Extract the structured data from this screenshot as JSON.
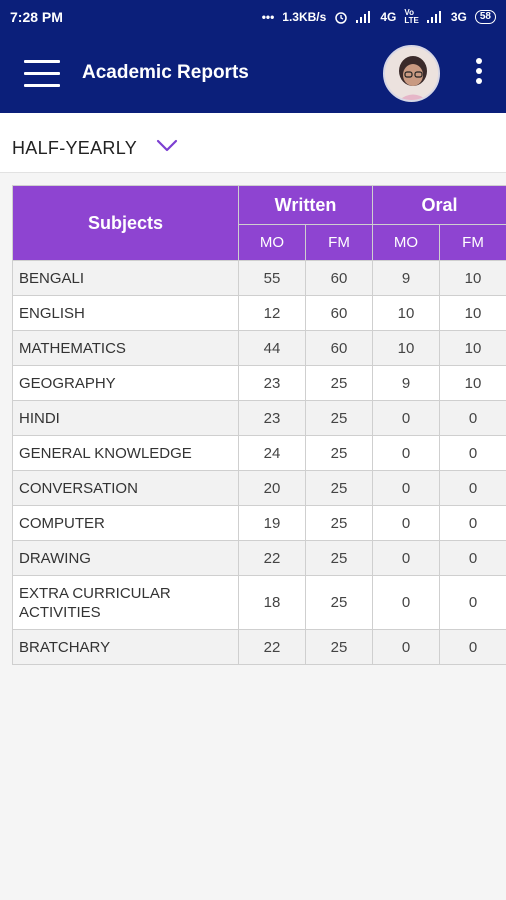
{
  "status_bar": {
    "time": "7:28 PM",
    "network_speed": "1.3KB/s",
    "network1": "4G",
    "network2": "3G",
    "battery": "58"
  },
  "app_bar": {
    "title": "Academic Reports",
    "menu_icon": "hamburger-menu-icon",
    "overflow_icon": "more-vert-icon"
  },
  "filter": {
    "selected": "HALF-YEARLY",
    "dropdown_icon": "chevron-down-icon",
    "accent": "#7c3fd1"
  },
  "colors": {
    "primary": "#0b1f7a",
    "table_header": "#8e44d1"
  },
  "table": {
    "headers": {
      "subjects": "Subjects",
      "written": "Written",
      "oral": "Oral",
      "mo": "MO",
      "fm": "FM"
    },
    "rows": [
      {
        "subject": "BENGALI",
        "written_mo": "55",
        "written_fm": "60",
        "oral_mo": "9",
        "oral_fm": "10"
      },
      {
        "subject": "ENGLISH",
        "written_mo": "12",
        "written_fm": "60",
        "oral_mo": "10",
        "oral_fm": "10"
      },
      {
        "subject": "MATHEMATICS",
        "written_mo": "44",
        "written_fm": "60",
        "oral_mo": "10",
        "oral_fm": "10"
      },
      {
        "subject": "GEOGRAPHY",
        "written_mo": "23",
        "written_fm": "25",
        "oral_mo": "9",
        "oral_fm": "10"
      },
      {
        "subject": "HINDI",
        "written_mo": "23",
        "written_fm": "25",
        "oral_mo": "0",
        "oral_fm": "0"
      },
      {
        "subject": "GENERAL KNOWLEDGE",
        "written_mo": "24",
        "written_fm": "25",
        "oral_mo": "0",
        "oral_fm": "0"
      },
      {
        "subject": "CONVERSATION",
        "written_mo": "20",
        "written_fm": "25",
        "oral_mo": "0",
        "oral_fm": "0"
      },
      {
        "subject": "COMPUTER",
        "written_mo": "19",
        "written_fm": "25",
        "oral_mo": "0",
        "oral_fm": "0"
      },
      {
        "subject": "DRAWING",
        "written_mo": "22",
        "written_fm": "25",
        "oral_mo": "0",
        "oral_fm": "0"
      },
      {
        "subject": "EXTRA CURRICULAR ACTIVITIES",
        "written_mo": "18",
        "written_fm": "25",
        "oral_mo": "0",
        "oral_fm": "0"
      },
      {
        "subject": "BRATCHARY",
        "written_mo": "22",
        "written_fm": "25",
        "oral_mo": "0",
        "oral_fm": "0"
      }
    ]
  }
}
